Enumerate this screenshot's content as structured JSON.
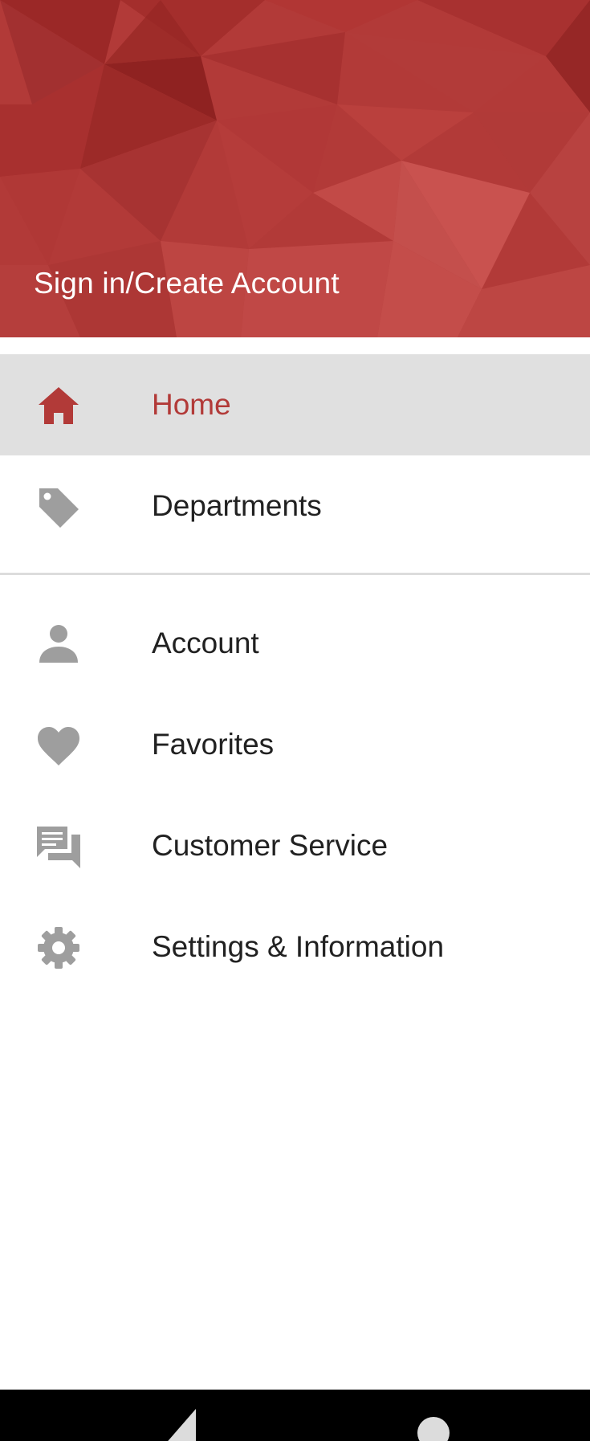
{
  "theme": {
    "accent": "#b23a38",
    "selected_background": "#e0e0e0",
    "icon_color": "#9e9e9e",
    "text_color": "#212121",
    "divider_color": "#dcdcdc"
  },
  "header": {
    "signin_label": "Sign in/Create Account"
  },
  "menu": {
    "primary": [
      {
        "label": "Home",
        "icon": "home-icon",
        "selected": true
      },
      {
        "label": "Departments",
        "icon": "tag-icon",
        "selected": false
      }
    ],
    "secondary": [
      {
        "label": "Account",
        "icon": "person-icon"
      },
      {
        "label": "Favorites",
        "icon": "heart-icon"
      },
      {
        "label": "Customer Service",
        "icon": "chat-icon"
      },
      {
        "label": "Settings & Information",
        "icon": "gear-icon"
      }
    ]
  },
  "system_nav": {
    "back": "back-icon",
    "home": "home-circle-icon"
  }
}
